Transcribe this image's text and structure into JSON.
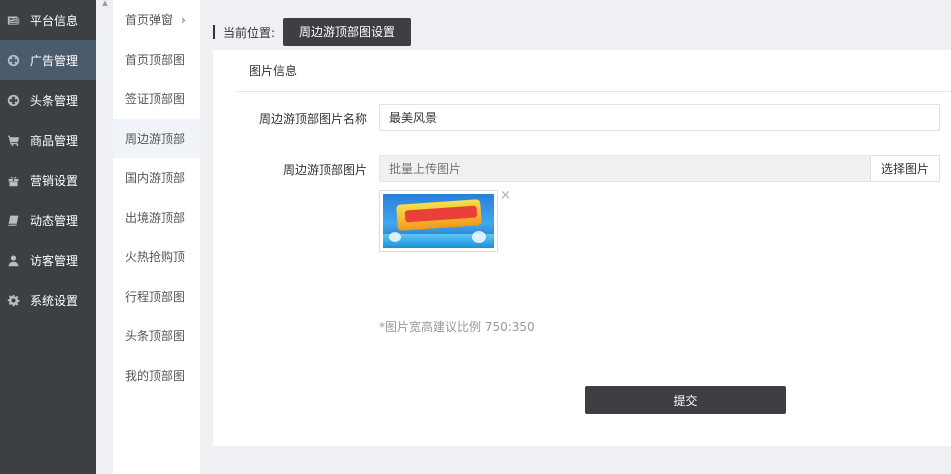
{
  "sidebar": {
    "items": [
      {
        "label": "平台信息",
        "icon": "newspaper-icon"
      },
      {
        "label": "广告管理",
        "icon": "lifebuoy-icon",
        "active": true
      },
      {
        "label": "头条管理",
        "icon": "lifebuoy-icon"
      },
      {
        "label": "商品管理",
        "icon": "cart-icon"
      },
      {
        "label": "营销设置",
        "icon": "gift-icon"
      },
      {
        "label": "动态管理",
        "icon": "book-icon"
      },
      {
        "label": "访客管理",
        "icon": "user-icon"
      },
      {
        "label": "系统设置",
        "icon": "gear-icon"
      }
    ]
  },
  "subnav": {
    "items": [
      {
        "label": "首页弹窗"
      },
      {
        "label": "首页顶部图"
      },
      {
        "label": "签证顶部图"
      },
      {
        "label": "周边游顶部",
        "active": true
      },
      {
        "label": "国内游顶部"
      },
      {
        "label": "出境游顶部"
      },
      {
        "label": "火热抢购顶"
      },
      {
        "label": "行程顶部图"
      },
      {
        "label": "头条顶部图"
      },
      {
        "label": "我的顶部图"
      }
    ],
    "chevron": "›"
  },
  "breadcrumb": {
    "label": "当前位置:",
    "current": "周边游顶部图设置"
  },
  "form": {
    "section_title": "图片信息",
    "name_label": "周边游顶部图片名称",
    "name_value": "最美风景",
    "image_label": "周边游顶部图片",
    "upload_placeholder": "批量上传图片",
    "choose_button": "选择图片",
    "remove_glyph": "×",
    "hint": "*图片宽高建议比例 750:350",
    "submit": "提交"
  },
  "colors": {
    "sidebar_bg": "#3c3f44",
    "sidebar_active": "#4a5b6e",
    "dark_button": "#3d3f43",
    "page_bg": "#eef0f3"
  }
}
